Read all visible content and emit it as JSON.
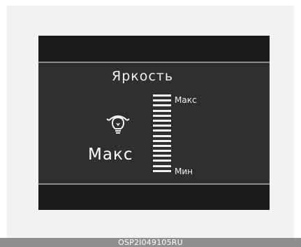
{
  "screen": {
    "title": "Яркость",
    "current_value_label": "Макс",
    "icon": "brightness-icon",
    "scale": {
      "max_label": "Макс",
      "min_label": "Мин",
      "level_fraction": 1.0,
      "steps_total": 16
    }
  },
  "footer": {
    "caption": "OSP2I049105RU"
  }
}
